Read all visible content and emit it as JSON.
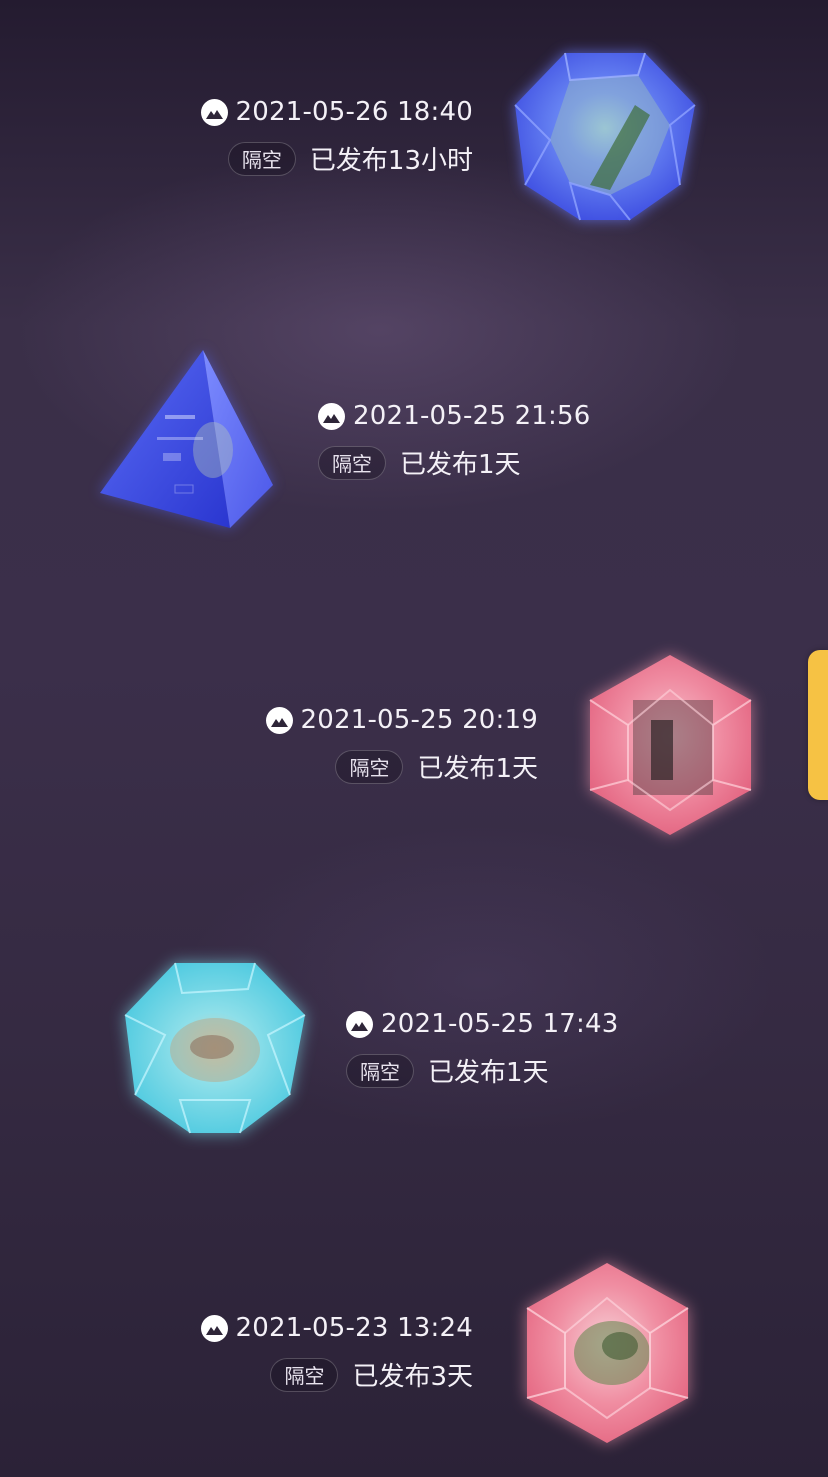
{
  "posts": [
    {
      "date": "2021-05-26 18:40",
      "tag": "隔空",
      "status": "已发布13小时",
      "crystal": "blue-dodecahedron"
    },
    {
      "date": "2021-05-25 21:56",
      "tag": "隔空",
      "status": "已发布1天",
      "crystal": "blue-pyramid"
    },
    {
      "date": "2021-05-25 20:19",
      "tag": "隔空",
      "status": "已发布1天",
      "crystal": "pink-hexagon"
    },
    {
      "date": "2021-05-25 17:43",
      "tag": "隔空",
      "status": "已发布1天",
      "crystal": "cyan-dodecahedron"
    },
    {
      "date": "2021-05-23 13:24",
      "tag": "隔空",
      "status": "已发布3天",
      "crystal": "pink-hexagon"
    }
  ],
  "colors": {
    "background": "#352a42",
    "side_tab": "#f6c244",
    "blue_crystal": "#4a5cf0",
    "pink_crystal": "#f07a92",
    "cyan_crystal": "#5fd6ea"
  },
  "icons": {
    "date_icon": "photo-icon"
  }
}
